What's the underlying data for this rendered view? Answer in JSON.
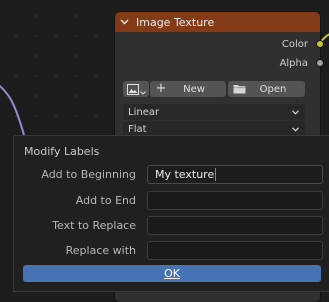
{
  "node": {
    "title": "Image Texture",
    "outputs": [
      {
        "label": "Color",
        "color": "#c7c729"
      },
      {
        "label": "Alpha",
        "color": "#a1a1a1"
      }
    ],
    "new_label": "New",
    "open_label": "Open",
    "interpolation": "Linear",
    "projection": "Flat"
  },
  "dialog": {
    "title": "Modify Labels",
    "fields": [
      {
        "label": "Add to Beginning",
        "value": "My texture"
      },
      {
        "label": "Add to End",
        "value": ""
      },
      {
        "label": "Text to Replace",
        "value": ""
      },
      {
        "label": "Replace with",
        "value": ""
      }
    ],
    "ok_label": "OK"
  },
  "colors": {
    "node_header": "#833a17",
    "ok_button": "#4772b3",
    "wire": "#8f8fd6"
  }
}
